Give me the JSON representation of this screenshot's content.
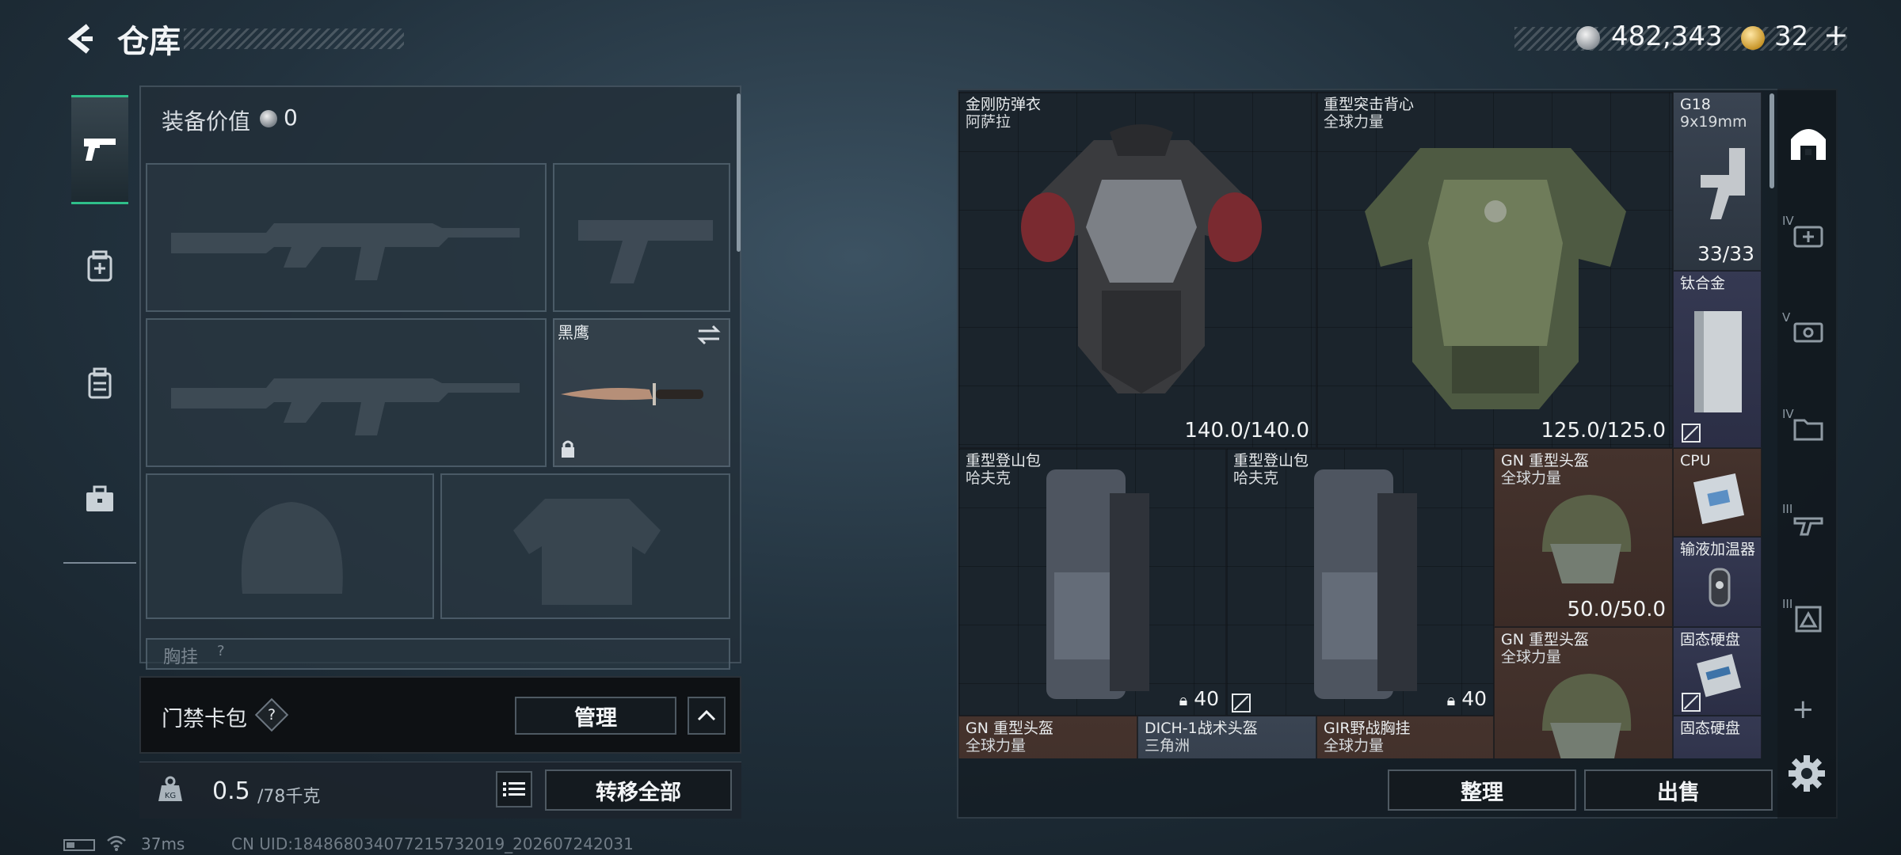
{
  "header": {
    "title": "仓库"
  },
  "currency": {
    "silver": "482,343",
    "gold": "32",
    "gold_plus": "+"
  },
  "equipment": {
    "value_label": "装备价值",
    "value": "0",
    "melee_name": "黑鹰",
    "chest_label": "胸挂",
    "chest_help": "?"
  },
  "keycard": {
    "label": "门禁卡包",
    "help": "?",
    "manage_label": "管理"
  },
  "weight": {
    "current": "0.5",
    "max": "/78千克",
    "icon_text": "KG"
  },
  "transfer_label": "转移全部",
  "status": {
    "ping": "37ms",
    "uid": "CN UID:18486803407721573201​9_202607242031"
  },
  "storage": {
    "items": [
      {
        "name": "金刚防弹衣",
        "sub": "阿萨拉",
        "durability": "140.0/140.0"
      },
      {
        "name": "重型突击背心",
        "sub": "全球力量",
        "durability": "125.0/125.0"
      },
      {
        "name": "G18",
        "sub": "9x19mm",
        "ammo": "33/33"
      },
      {
        "name": "钛合金"
      },
      {
        "name": "重型登山包",
        "sub": "哈夫克",
        "count": "40"
      },
      {
        "name": "重型登山包",
        "sub": "哈夫克",
        "count": "40"
      },
      {
        "name": "GN 重型头盔",
        "sub": "全球力量",
        "durability": "50.0/50.0"
      },
      {
        "name": "CPU"
      },
      {
        "name": "输液加温器"
      },
      {
        "name": "GN 重型头盔",
        "sub": "全球力量"
      },
      {
        "name": "固态硬盘"
      },
      {
        "name": "GN 重型头盔",
        "sub": "全球力量"
      },
      {
        "name": "DICH-1战术头盔",
        "sub": "三角洲"
      },
      {
        "name": "GIR野战胸挂",
        "sub": "全球力量"
      },
      {
        "name": "固态硬盘"
      }
    ],
    "sort_label": "整理",
    "sell_label": "出售"
  },
  "rail": {
    "tiers": [
      "IV",
      "V",
      "IV",
      "III",
      "III"
    ],
    "add": "+"
  },
  "colors": {
    "accent_green": "#2fbf8a",
    "red_cell": "#5c2228",
    "brown_cell": "#45332d",
    "navy_cell": "#353952"
  }
}
